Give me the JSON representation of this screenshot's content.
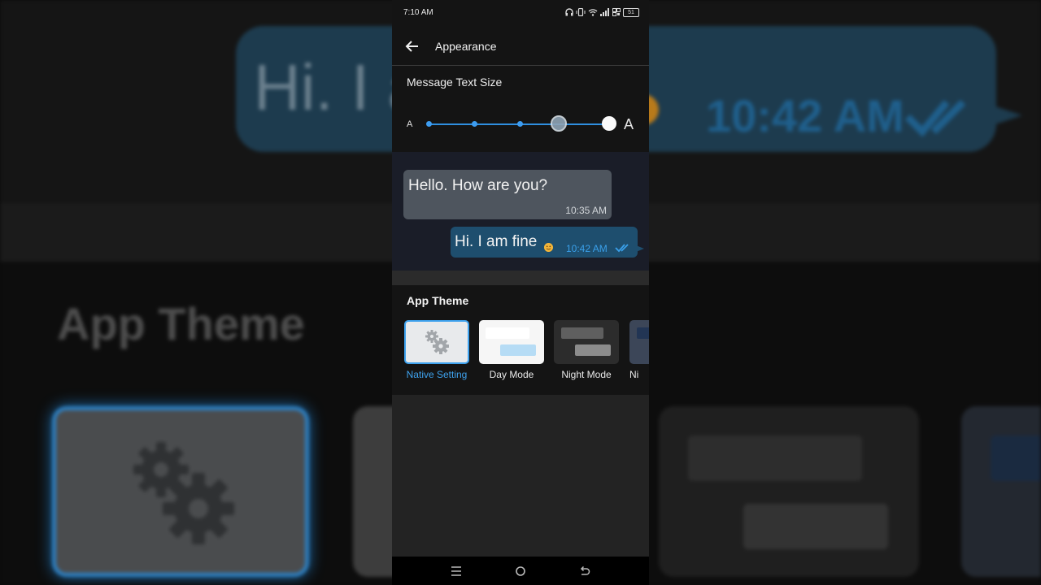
{
  "status_bar": {
    "time": "7:10 AM",
    "battery": "51"
  },
  "app_bar": {
    "title": "Appearance",
    "back_icon": "arrow-left-icon"
  },
  "text_size": {
    "title": "Message Text Size",
    "small_label": "A",
    "large_label": "A",
    "steps": 5,
    "selected_step": 5
  },
  "preview": {
    "incoming": {
      "text": "Hello. How are you?",
      "time": "10:35 AM"
    },
    "outgoing": {
      "text": "Hi. I am fine",
      "time": "10:42 AM",
      "emoji": "smiling-face-icon",
      "status_icon": "double-check-icon"
    }
  },
  "app_theme": {
    "title": "App Theme",
    "options": [
      {
        "label": "Native Setting",
        "selected": true
      },
      {
        "label": "Day Mode",
        "selected": false
      },
      {
        "label": "Night Mode",
        "selected": false
      },
      {
        "label": "Ni",
        "selected": false
      }
    ]
  },
  "nav_bar": {
    "icons": [
      "menu-icon",
      "home-icon",
      "back-icon"
    ]
  },
  "colors": {
    "accent": "#3ea2ee",
    "outgoing_bubble": "#1e4e6e",
    "incoming_bubble": "#4e555e",
    "outgoing_time": "#3aa0ea"
  },
  "background_echo": {
    "message_text": "Hi. I a",
    "time": "10:42 AM",
    "section_title": "App Theme"
  }
}
